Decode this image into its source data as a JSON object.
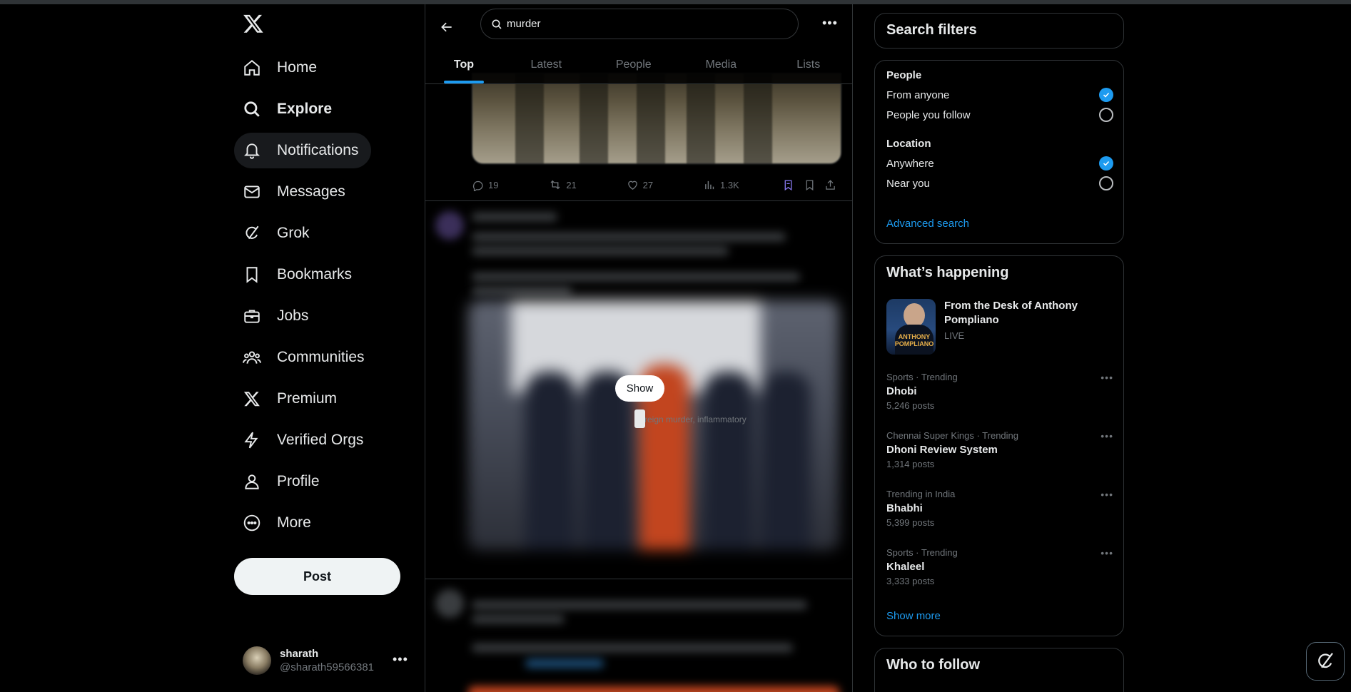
{
  "nav": {
    "items": [
      {
        "label": "Home",
        "icon": "home-icon"
      },
      {
        "label": "Explore",
        "icon": "search-icon"
      },
      {
        "label": "Notifications",
        "icon": "bell-icon"
      },
      {
        "label": "Messages",
        "icon": "mail-icon"
      },
      {
        "label": "Grok",
        "icon": "grok-icon"
      },
      {
        "label": "Bookmarks",
        "icon": "bookmark-icon"
      },
      {
        "label": "Jobs",
        "icon": "briefcase-icon"
      },
      {
        "label": "Communities",
        "icon": "people-icon"
      },
      {
        "label": "Premium",
        "icon": "x-logo-icon"
      },
      {
        "label": "Verified Orgs",
        "icon": "lightning-icon"
      },
      {
        "label": "Profile",
        "icon": "person-icon"
      },
      {
        "label": "More",
        "icon": "more-circle-icon"
      }
    ],
    "post_label": "Post"
  },
  "account": {
    "name": "sharath",
    "handle": "@sharath59566381"
  },
  "search": {
    "value": "murder"
  },
  "tabs": [
    "Top",
    "Latest",
    "People",
    "Media",
    "Lists"
  ],
  "post1": {
    "replies": "19",
    "reposts": "21",
    "likes": "27",
    "views": "1.3K"
  },
  "sensitive": {
    "show_label": "Show",
    "warning": "Foreign murder, inflammatory"
  },
  "filters": {
    "title": "Search filters",
    "people_heading": "People",
    "people_options": [
      "From anyone",
      "People you follow"
    ],
    "location_heading": "Location",
    "location_options": [
      "Anywhere",
      "Near you"
    ],
    "advanced": "Advanced search"
  },
  "happening": {
    "title": "What’s happening",
    "live": {
      "title": "From the Desk of Anthony Pompliano",
      "status": "LIVE",
      "thumb_text": "ANTHONY POMPLIANO"
    },
    "trends": [
      {
        "meta": "Sports · Trending",
        "name": "Dhobi",
        "count": "5,246 posts"
      },
      {
        "meta": "Chennai Super Kings · Trending",
        "name": "Dhoni Review System",
        "count": "1,314 posts"
      },
      {
        "meta": "Trending in India",
        "name": "Bhabhi",
        "count": "5,399 posts"
      },
      {
        "meta": "Sports · Trending",
        "name": "Khaleel",
        "count": "3,333 posts"
      }
    ],
    "show_more": "Show more"
  },
  "who_to_follow": {
    "title": "Who to follow"
  },
  "colors": {
    "accent": "#1d9bf0",
    "background": "#000000",
    "border": "#2f3336",
    "muted": "#71767b"
  }
}
